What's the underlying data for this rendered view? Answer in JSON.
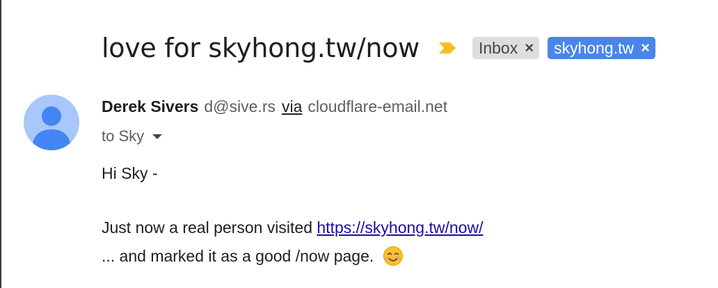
{
  "email": {
    "subject": "love for skyhong.tw/now",
    "labels": [
      {
        "text": "Inbox",
        "remove": "×",
        "color": "#dddddd"
      },
      {
        "text": "skyhong.tw",
        "remove": "×",
        "color": "#4a86e8"
      }
    ],
    "importance_marker_icon": "important-arrow-icon",
    "importance_color": "#f6bf26",
    "sender": {
      "name": "Derek Sivers",
      "email": "d@sive.rs",
      "via_label": "via",
      "via_domain": "cloudflare-email.net",
      "avatar_icon": "person-avatar-icon",
      "avatar_color": "#a8c7fa"
    },
    "recipient": {
      "text": "to Sky",
      "details_icon": "caret-down-icon"
    },
    "body": {
      "greeting": "Hi Sky -",
      "line1_prefix": "Just now a real person visited ",
      "line1_link": "https://skyhong.tw/now/",
      "line2": "... and marked it as a good /now page.",
      "emoji_icon": "smiling-face-emoji-icon"
    },
    "link_color": "#1a0dab"
  }
}
